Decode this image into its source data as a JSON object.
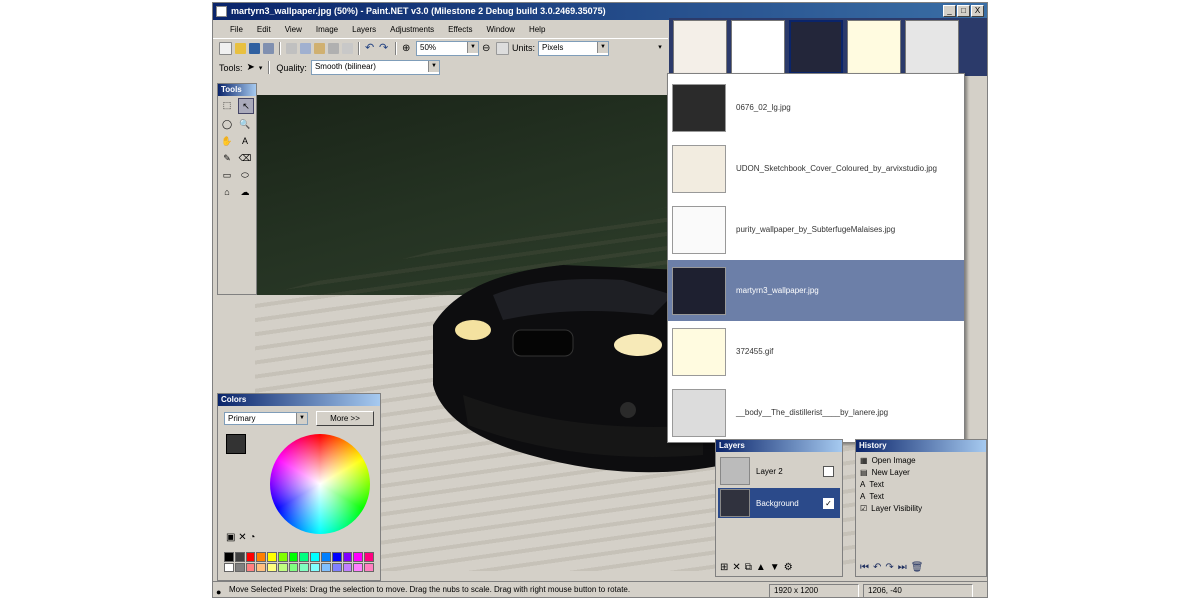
{
  "window": {
    "title": "martyrn3_wallpaper.jpg (50%) - Paint.NET v3.0 (Milestone 2 Debug build 3.0.2469.35075)",
    "min": "_",
    "max": "□",
    "close": "X"
  },
  "menu": [
    "File",
    "Edit",
    "View",
    "Image",
    "Layers",
    "Adjustments",
    "Effects",
    "Window",
    "Help"
  ],
  "toolbar": {
    "zoom_value": "50%",
    "units_label": "Units:",
    "units_value": "Pixels",
    "tools_label": "Tools:",
    "quality_label": "Quality:",
    "quality_value": "Smooth (bilinear)"
  },
  "tools_panel": {
    "title": "Tools",
    "glyphs": [
      "⬚",
      "↖",
      "◯",
      "🔍",
      "✋",
      "A",
      "✎",
      "⌫",
      "▭",
      "⬭",
      "⌂",
      "☁"
    ]
  },
  "colors_panel": {
    "title": "Colors",
    "mode": "Primary",
    "more_button": "More >>",
    "palette": [
      "#000000",
      "#404040",
      "#ff0000",
      "#ff8000",
      "#ffff00",
      "#80ff00",
      "#00ff00",
      "#00ff80",
      "#00ffff",
      "#0080ff",
      "#0000ff",
      "#8000ff",
      "#ff00ff",
      "#ff0080",
      "#ffffff",
      "#808080",
      "#ff8080",
      "#ffc080",
      "#ffff80",
      "#c0ff80",
      "#80ff80",
      "#80ffc0",
      "#80ffff",
      "#80c0ff",
      "#8080ff",
      "#c080ff",
      "#ff80ff",
      "#ff80c0"
    ]
  },
  "image_list": [
    {
      "name": "0676_02_lg.jpg",
      "selected": false
    },
    {
      "name": "UDON_Sketchbook_Cover_Coloured_by_arvixstudio.jpg",
      "selected": false
    },
    {
      "name": "purity_wallpaper_by_SubterfugeMalaises.jpg",
      "selected": false
    },
    {
      "name": "martyrn3_wallpaper.jpg",
      "selected": true
    },
    {
      "name": "372455.gif",
      "selected": false
    },
    {
      "name": "__body__The_distillerist____by_lanere.jpg",
      "selected": false
    }
  ],
  "layers_panel": {
    "title": "Layers",
    "layers": [
      {
        "name": "Layer 2",
        "visible": false,
        "selected": false
      },
      {
        "name": "Background",
        "visible": true,
        "selected": true
      }
    ]
  },
  "history_panel": {
    "title": "History",
    "items": [
      "Open Image",
      "New Layer",
      "Text",
      "Text",
      "Layer Visibility"
    ]
  },
  "status": {
    "message": "Move Selected Pixels: Drag the selection to move. Drag the nubs to scale. Drag with right mouse button to rotate.",
    "size": "1920 x 1200",
    "position": "1206, -40"
  }
}
